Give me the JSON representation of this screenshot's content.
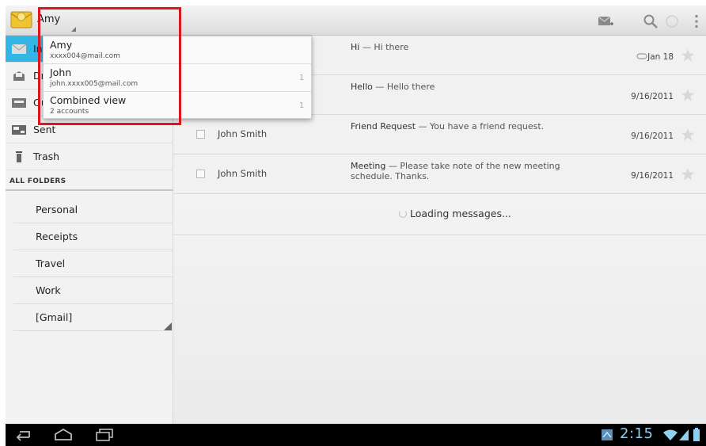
{
  "actionbar": {
    "account_selected": "Amy",
    "icons": [
      "app-logo-icon",
      "compose-icon",
      "search-icon",
      "refresh-icon",
      "overflow-menu-icon"
    ]
  },
  "account_dropdown": {
    "items": [
      {
        "title": "Amy",
        "subtitle": "xxxx004@mail.com",
        "count": ""
      },
      {
        "title": "John",
        "subtitle": "john.xxxx005@mail.com",
        "count": "1"
      },
      {
        "title": "Combined view",
        "subtitle": "2 accounts",
        "count": "1"
      }
    ]
  },
  "nav": {
    "items": [
      {
        "label": "Inbox",
        "icon": "inbox-icon",
        "active": true
      },
      {
        "label": "Drafts",
        "icon": "drafts-icon",
        "active": false
      },
      {
        "label": "Outbox",
        "icon": "outbox-icon",
        "active": false
      },
      {
        "label": "Sent",
        "icon": "sent-icon",
        "active": false
      },
      {
        "label": "Trash",
        "icon": "trash-icon",
        "active": false
      }
    ],
    "folders_header": "ALL FOLDERS",
    "folders": [
      "Personal",
      "Receipts",
      "Travel",
      "Work",
      "[Gmail]"
    ]
  },
  "messages": [
    {
      "sender": "",
      "subject": "Hi",
      "snippet": "Hi there",
      "date": "Jan 18",
      "attachment": true
    },
    {
      "sender": "",
      "subject": "Hello",
      "snippet": "Hello there",
      "date": "9/16/2011",
      "attachment": false
    },
    {
      "sender": "John Smith",
      "subject": "Friend Request",
      "snippet": "You have a friend request.",
      "date": "9/16/2011",
      "attachment": false
    },
    {
      "sender": "John Smith",
      "subject": "Meeting",
      "snippet": "Please take note of the new meeting schedule. Thanks.",
      "date": "9/16/2011",
      "attachment": false
    }
  ],
  "loading_text": "Loading messages...",
  "systembar": {
    "clock": "2:15",
    "icons": [
      "back-icon",
      "home-icon",
      "recent-apps-icon",
      "notification-icon",
      "wifi-icon",
      "signal-icon",
      "battery-icon"
    ]
  },
  "colors": {
    "accent": "#33b5e5",
    "highlight": "#e0141e",
    "clock": "#8fd0ee"
  }
}
